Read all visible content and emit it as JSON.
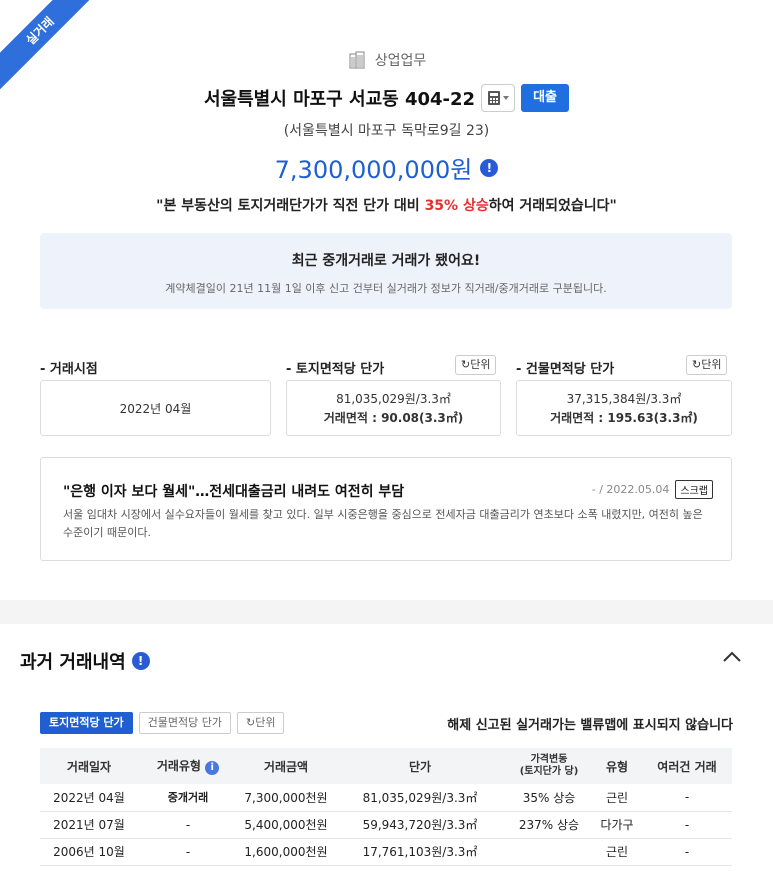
{
  "ribbon": {
    "label": "실거래"
  },
  "header": {
    "category": "상업업무",
    "address": "서울특별시 마포구 서교동 404-22",
    "loan_button": "대출",
    "road_address": "(서울특별시 마포구 독막로9길 23)",
    "price": "7,300,000,000원",
    "headline_prefix": "\"본 부동산의 토지거래단가가 직전 단가 대비 ",
    "headline_highlight": "35% 상승",
    "headline_suffix": "하여 거래되었습니다\""
  },
  "notice": {
    "title": "최근 중개거래로 거래가 됐어요!",
    "desc": "계약체결일이 21년 11월 1일 이후 신고 건부터 실거래가 정보가 직거래/중개거래로 구분됩니다."
  },
  "metrics": {
    "unit_label": "단위",
    "trade_time": {
      "label": "- 거래시점",
      "value": "2022년 04월"
    },
    "land_price": {
      "label": "- 토지면적당 단가",
      "line1": "81,035,029원/3.3㎡",
      "line2": "거래면적 : 90.08(3.3㎡)"
    },
    "building_price": {
      "label": "- 건물면적당 단가",
      "line1": "37,315,384원/3.3㎡",
      "line2": "거래면적 : 195.63(3.3㎡)"
    }
  },
  "news": {
    "title": "\"은행 이자 보다 월세\"…전세대출금리 내려도 여전히 부담",
    "meta": "- / 2022.05.04",
    "scrap": "스크랩",
    "body": "서울 임대차 시장에서 실수요자들이 월세를 찾고 있다. 일부 시중은행을 중심으로 전세자금 대출금리가 연초보다 소폭 내렸지만, 여전히 높은 수준이기 때문이다."
  },
  "history": {
    "title": "과거 거래내역",
    "tabs": [
      "토지면적당 단가",
      "건물면적당 단가"
    ],
    "unit_label": "단위",
    "note": "해제 신고된 실거래가는 밸류맵에 표시되지 않습니다",
    "columns": [
      "거래일자",
      "거래유형",
      "거래금액",
      "단가",
      "가격변동",
      "(토지단가 당)",
      "유형",
      "여러건 거래"
    ],
    "rows": [
      {
        "date": "2022년 04월",
        "type": "중개거래",
        "amount": "7,300,000천원",
        "unit_price": "81,035,029원/3.3㎡",
        "change": "35% 상승",
        "kind": "근린",
        "multi": "-"
      },
      {
        "date": "2021년 07월",
        "type": "-",
        "amount": "5,400,000천원",
        "unit_price": "59,943,720원/3.3㎡",
        "change": "237% 상승",
        "kind": "다가구",
        "multi": "-"
      },
      {
        "date": "2006년 10월",
        "type": "-",
        "amount": "1,600,000천원",
        "unit_price": "17,761,103원/3.3㎡",
        "change": "",
        "kind": "근린",
        "multi": "-"
      }
    ]
  },
  "colors": {
    "accent": "#1f5fd0",
    "highlight": "#e53030",
    "notice_bg": "#eef2fb"
  }
}
